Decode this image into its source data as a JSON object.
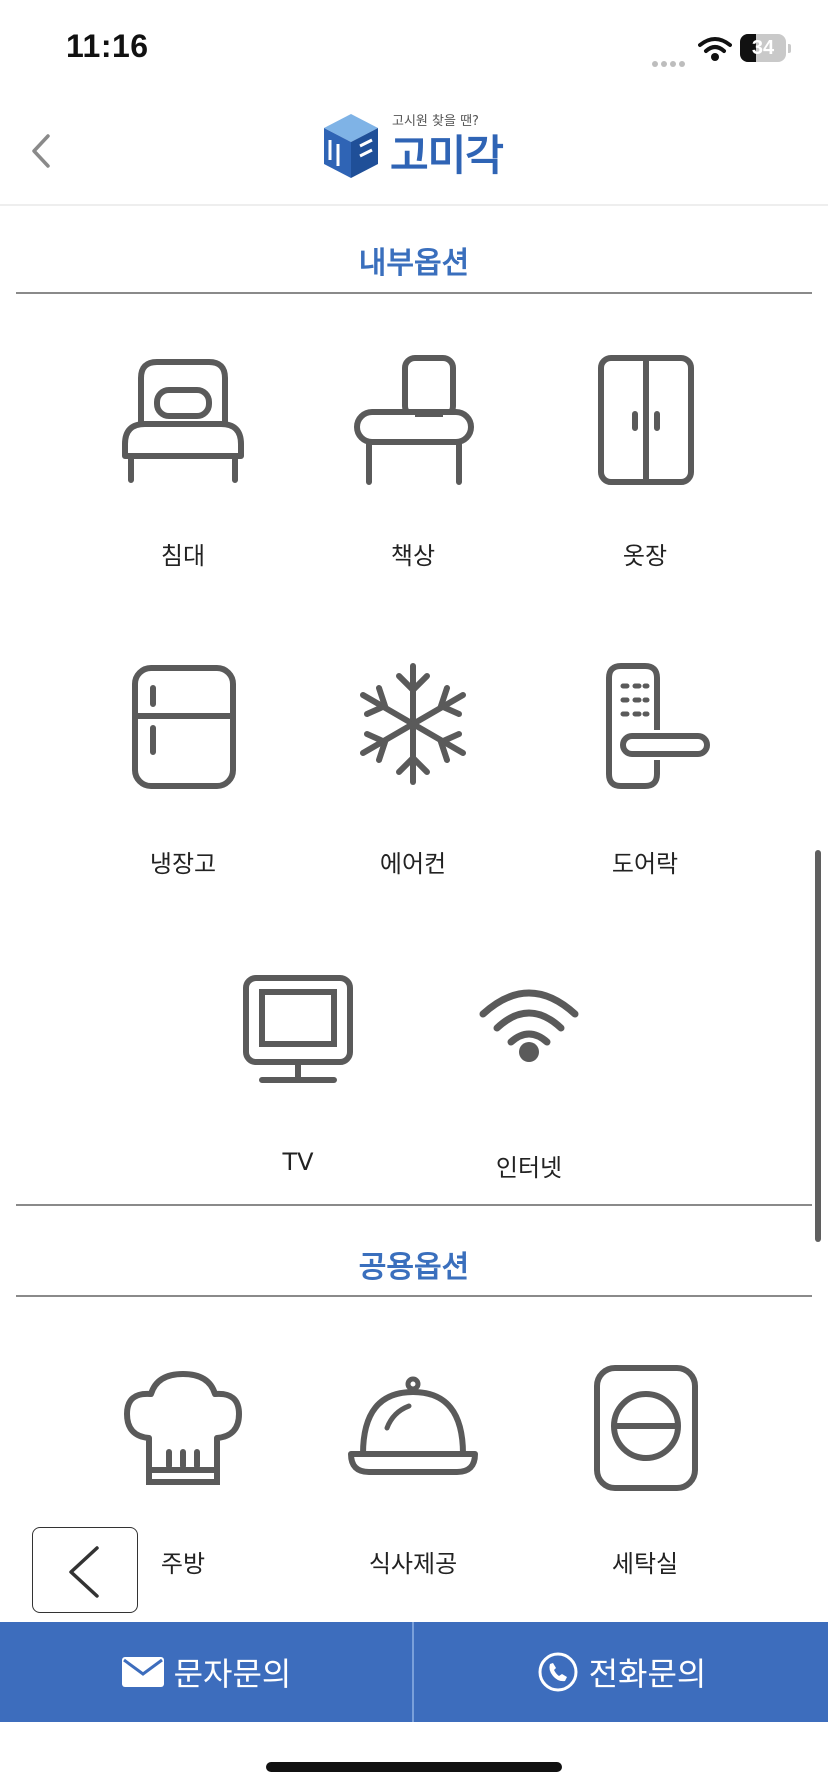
{
  "status_bar": {
    "time": "11:16",
    "battery": "34",
    "battery_level": 0.34
  },
  "header": {
    "logo_tagline": "고시원 찾을 땐?",
    "logo_word": "고미각"
  },
  "sections": {
    "internal": {
      "title": "내부옵션",
      "items": [
        "침대",
        "책상",
        "옷장",
        "냉장고",
        "에어컨",
        "도어락",
        "TV",
        "인터넷"
      ]
    },
    "shared": {
      "title": "공용옵션",
      "items": [
        "주방",
        "식사제공",
        "세탁실"
      ]
    }
  },
  "bottom_bar": {
    "sms_label": "문자문의",
    "call_label": "전화문의"
  },
  "colors": {
    "accent": "#3d6dbd",
    "title": "#3a6fbd",
    "icon": "#5a5a5a"
  },
  "icons": [
    "back-chevron-icon",
    "bed-icon",
    "desk-icon",
    "wardrobe-icon",
    "refrigerator-icon",
    "air-conditioner-icon",
    "door-lock-icon",
    "tv-icon",
    "wifi-icon",
    "chef-hat-icon",
    "cloche-icon",
    "washing-machine-icon",
    "envelope-icon",
    "phone-icon"
  ]
}
